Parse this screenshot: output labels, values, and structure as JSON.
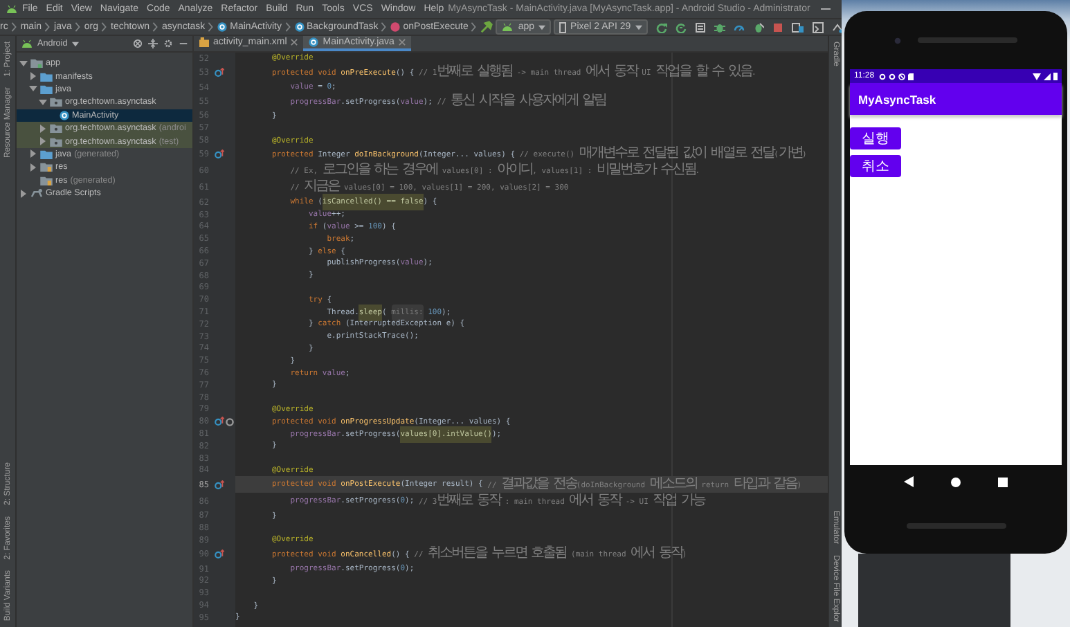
{
  "window": {
    "title": "MyAsyncTask - MainActivity.java [MyAsyncTask.app] - Android Studio - Administrator"
  },
  "menu": [
    "File",
    "Edit",
    "View",
    "Navigate",
    "Code",
    "Analyze",
    "Refactor",
    "Build",
    "Run",
    "Tools",
    "VCS",
    "Window",
    "Help"
  ],
  "breadcrumbs": [
    {
      "text": "rc",
      "kind": "folder"
    },
    {
      "text": "main",
      "kind": "folder"
    },
    {
      "text": "java",
      "kind": "folder"
    },
    {
      "text": "org",
      "kind": "folder"
    },
    {
      "text": "techtown",
      "kind": "folder"
    },
    {
      "text": "asynctask",
      "kind": "folder"
    },
    {
      "text": "MainActivity",
      "kind": "class"
    },
    {
      "text": "BackgroundTask",
      "kind": "class"
    },
    {
      "text": "onPostExecute",
      "kind": "method"
    }
  ],
  "run_config": "app",
  "device": "Pixel 2 API 29",
  "left_strip": {
    "top": [
      "1: Project",
      "Resource Manager"
    ],
    "bottom": [
      "2: Structure",
      "2: Favorites",
      "Build Variants"
    ]
  },
  "project": {
    "view": "Android",
    "tree": [
      {
        "name": "app",
        "kind": "module",
        "expanded": true,
        "selected": false,
        "children": [
          {
            "name": "manifests",
            "kind": "folder",
            "expanded": false,
            "selected": false
          },
          {
            "name": "java",
            "kind": "folder",
            "expanded": true,
            "selected": false,
            "children": [
              {
                "name": "org.techtown.asynctask",
                "kind": "package",
                "expanded": true,
                "selected": false,
                "children": [
                  {
                    "name": "MainActivity",
                    "kind": "class",
                    "selected": true
                  }
                ]
              },
              {
                "name": "org.techtown.asynctask",
                "note": "(androi",
                "kind": "test-package",
                "expanded": false,
                "selected": false
              },
              {
                "name": "org.techtown.asynctask",
                "note": "(test)",
                "kind": "test-package",
                "expanded": false,
                "selected": false
              }
            ]
          },
          {
            "name": "java",
            "note": "(generated)",
            "kind": "folder",
            "expanded": false,
            "selected": false
          },
          {
            "name": "res",
            "kind": "res-folder",
            "expanded": false,
            "selected": false
          },
          {
            "name": "res",
            "note": "(generated)",
            "kind": "res-folder",
            "selected": false
          }
        ]
      },
      {
        "name": "Gradle Scripts",
        "kind": "scripts",
        "expanded": false,
        "selected": false
      }
    ]
  },
  "tabs": [
    {
      "label": "activity_main.xml",
      "kind": "layout",
      "selected": false
    },
    {
      "label": "MainActivity.java",
      "kind": "class",
      "selected": true
    }
  ],
  "editor": {
    "lines": [
      {
        "number": "52",
        "current": false,
        "segments": [
          {
            "kind": "annotation",
            "text": "        @Override"
          }
        ]
      },
      {
        "number": "53",
        "current": false,
        "gutter_icons": [
          {
            "kind": "override"
          }
        ],
        "segments": [
          {
            "kind": "keyword",
            "text": "        protected void "
          },
          {
            "kind": "method",
            "text": "onPreExecute"
          },
          {
            "kind": "plain",
            "text": "() { "
          },
          {
            "kind": "comment",
            "text": "// 1번째로 실행됨 -> main thread 에서 동작 UI 작업을 할 수 있음."
          }
        ]
      },
      {
        "number": "54",
        "current": false,
        "segments": [
          {
            "kind": "field",
            "text": "            value"
          },
          {
            "kind": "plain",
            "text": " = "
          },
          {
            "kind": "number",
            "text": "0"
          },
          {
            "kind": "plain",
            "text": ";"
          }
        ]
      },
      {
        "number": "55",
        "current": false,
        "segments": [
          {
            "kind": "field",
            "text": "            progressBar"
          },
          {
            "kind": "plain",
            "text": ".setProgress("
          },
          {
            "kind": "field",
            "text": "value"
          },
          {
            "kind": "plain",
            "text": "); "
          },
          {
            "kind": "comment",
            "text": "// 통신 시작을 사용자에게 알림"
          }
        ]
      },
      {
        "number": "56",
        "current": false,
        "segments": [
          {
            "kind": "plain",
            "text": "        }"
          }
        ]
      },
      {
        "number": "57",
        "current": false
      },
      {
        "number": "58",
        "current": false,
        "segments": [
          {
            "kind": "annotation",
            "text": "        @Override"
          }
        ]
      },
      {
        "number": "59",
        "current": false,
        "gutter_icons": [
          {
            "kind": "override"
          }
        ],
        "segments": [
          {
            "kind": "keyword",
            "text": "        protected "
          },
          {
            "kind": "plain",
            "text": "Integer "
          },
          {
            "kind": "method",
            "text": "doInBackground"
          },
          {
            "kind": "plain",
            "text": "(Integer... values) { "
          },
          {
            "kind": "comment",
            "text": "// execute() 매개변수로 전달된 값이 배열로 전달(가변)"
          }
        ]
      },
      {
        "number": "60",
        "current": false,
        "segments": [
          {
            "kind": "comment",
            "text": "            // Ex, 로그인을 하는 경우에 values[0] : 아이디, values[1] : 비밀번호가 수신됨."
          }
        ]
      },
      {
        "number": "61",
        "current": false,
        "segments": [
          {
            "kind": "comment",
            "text": "            // 지금은 values[0] = 100, values[1] = 200, values[2] = 300"
          }
        ]
      },
      {
        "number": "62",
        "current": false,
        "segments": [
          {
            "kind": "keyword",
            "text": "            while "
          },
          {
            "kind": "plain",
            "text": "("
          },
          {
            "kind": "mark",
            "text": "isCancelled() == false"
          },
          {
            "kind": "plain",
            "text": ") {"
          }
        ]
      },
      {
        "number": "63",
        "current": false,
        "segments": [
          {
            "kind": "field",
            "text": "                value"
          },
          {
            "kind": "plain",
            "text": "++;"
          }
        ]
      },
      {
        "number": "64",
        "current": false,
        "segments": [
          {
            "kind": "keyword",
            "text": "                if "
          },
          {
            "kind": "plain",
            "text": "("
          },
          {
            "kind": "field",
            "text": "value"
          },
          {
            "kind": "plain",
            "text": " >= "
          },
          {
            "kind": "number",
            "text": "100"
          },
          {
            "kind": "plain",
            "text": ") {"
          }
        ]
      },
      {
        "number": "65",
        "current": false,
        "segments": [
          {
            "kind": "keyword",
            "text": "                    break"
          },
          {
            "kind": "plain",
            "text": ";"
          }
        ]
      },
      {
        "number": "66",
        "current": false,
        "segments": [
          {
            "kind": "plain",
            "text": "                } "
          },
          {
            "kind": "keyword",
            "text": "else "
          },
          {
            "kind": "plain",
            "text": "{"
          }
        ]
      },
      {
        "number": "67",
        "current": false,
        "segments": [
          {
            "kind": "plain",
            "text": "                    publishProgress("
          },
          {
            "kind": "field",
            "text": "value"
          },
          {
            "kind": "plain",
            "text": ");"
          }
        ]
      },
      {
        "number": "68",
        "current": false,
        "segments": [
          {
            "kind": "plain",
            "text": "                }"
          }
        ]
      },
      {
        "number": "69",
        "current": false
      },
      {
        "number": "70",
        "current": false,
        "segments": [
          {
            "kind": "keyword",
            "text": "                try "
          },
          {
            "kind": "plain",
            "text": "{"
          }
        ]
      },
      {
        "number": "71",
        "current": false,
        "segments": [
          {
            "kind": "plain",
            "text": "                    Thread."
          },
          {
            "kind": "mark",
            "text": "sleep"
          },
          {
            "kind": "plain",
            "text": "( "
          },
          {
            "kind": "hint",
            "text": "millis:"
          },
          {
            "kind": "number",
            "text": " 100"
          },
          {
            "kind": "plain",
            "text": ");"
          }
        ]
      },
      {
        "number": "72",
        "current": false,
        "segments": [
          {
            "kind": "plain",
            "text": "                } "
          },
          {
            "kind": "keyword",
            "text": "catch "
          },
          {
            "kind": "plain",
            "text": "(InterruptedException e) {"
          }
        ]
      },
      {
        "number": "73",
        "current": false,
        "segments": [
          {
            "kind": "plain",
            "text": "                    e.printStackTrace();"
          }
        ]
      },
      {
        "number": "74",
        "current": false,
        "segments": [
          {
            "kind": "plain",
            "text": "                }"
          }
        ]
      },
      {
        "number": "75",
        "current": false,
        "segments": [
          {
            "kind": "plain",
            "text": "            }"
          }
        ]
      },
      {
        "number": "76",
        "current": false,
        "segments": [
          {
            "kind": "keyword",
            "text": "            return "
          },
          {
            "kind": "field",
            "text": "value"
          },
          {
            "kind": "plain",
            "text": ";"
          }
        ]
      },
      {
        "number": "77",
        "current": false,
        "segments": [
          {
            "kind": "plain",
            "text": "        }"
          }
        ]
      },
      {
        "number": "78",
        "current": false
      },
      {
        "number": "79",
        "current": false,
        "segments": [
          {
            "kind": "annotation",
            "text": "        @Override"
          }
        ]
      },
      {
        "number": "80",
        "current": false,
        "gutter_icons": [
          {
            "kind": "override"
          },
          {
            "kind": "reference"
          }
        ],
        "segments": [
          {
            "kind": "keyword",
            "text": "        protected void "
          },
          {
            "kind": "method",
            "text": "onProgressUpdate"
          },
          {
            "kind": "plain",
            "text": "(Integer... values) {"
          }
        ]
      },
      {
        "number": "81",
        "current": false,
        "segments": [
          {
            "kind": "field",
            "text": "            progressBar"
          },
          {
            "kind": "plain",
            "text": ".setProgress("
          },
          {
            "kind": "mark",
            "text": "values[0].intValue()"
          },
          {
            "kind": "plain",
            "text": ");"
          }
        ]
      },
      {
        "number": "82",
        "current": false,
        "segments": [
          {
            "kind": "plain",
            "text": "        }"
          }
        ]
      },
      {
        "number": "83",
        "current": false
      },
      {
        "number": "84",
        "current": false,
        "segments": [
          {
            "kind": "annotation",
            "text": "        @Override"
          }
        ]
      },
      {
        "number": "85",
        "current": true,
        "gutter_icons": [
          {
            "kind": "override"
          }
        ],
        "segments": [
          {
            "kind": "keyword",
            "text": "        protected void "
          },
          {
            "kind": "method",
            "text": "onPostExecute"
          },
          {
            "kind": "plain",
            "text": "(Integer result) { "
          },
          {
            "kind": "comment",
            "text": "// 결과값을 전송(doInBackground 메소드의 return 타입과 같음)"
          }
        ]
      },
      {
        "number": "86",
        "current": false,
        "segments": [
          {
            "kind": "field",
            "text": "            progressBar"
          },
          {
            "kind": "plain",
            "text": ".setProgress("
          },
          {
            "kind": "number",
            "text": "0"
          },
          {
            "kind": "plain",
            "text": "); "
          },
          {
            "kind": "comment",
            "text": "// 3번째로 동작 : main thread 에서 동작 -> UI 작업 가능"
          }
        ]
      },
      {
        "number": "87",
        "current": false,
        "segments": [
          {
            "kind": "plain",
            "text": "        }"
          }
        ]
      },
      {
        "number": "88",
        "current": false
      },
      {
        "number": "89",
        "current": false,
        "segments": [
          {
            "kind": "annotation",
            "text": "        @Override"
          }
        ]
      },
      {
        "number": "90",
        "current": false,
        "gutter_icons": [
          {
            "kind": "override"
          }
        ],
        "segments": [
          {
            "kind": "keyword",
            "text": "        protected void "
          },
          {
            "kind": "method",
            "text": "onCancelled"
          },
          {
            "kind": "plain",
            "text": "() { "
          },
          {
            "kind": "comment",
            "text": "// 취소버튼을 누르면 호출됨 (main thread 에서 동작)"
          }
        ]
      },
      {
        "number": "91",
        "current": false,
        "segments": [
          {
            "kind": "field",
            "text": "            progressBar"
          },
          {
            "kind": "plain",
            "text": ".setProgress("
          },
          {
            "kind": "number",
            "text": "0"
          },
          {
            "kind": "plain",
            "text": ");"
          }
        ]
      },
      {
        "number": "92",
        "current": false,
        "segments": [
          {
            "kind": "plain",
            "text": "        }"
          }
        ]
      },
      {
        "number": "93",
        "current": false
      },
      {
        "number": "94",
        "current": false,
        "segments": [
          {
            "kind": "plain",
            "text": "    }"
          }
        ]
      },
      {
        "number": "95",
        "current": false,
        "segments": [
          {
            "kind": "plain",
            "text": "}"
          }
        ]
      }
    ]
  },
  "right_strip": {
    "top": [
      "Gradle"
    ],
    "bottom": [
      "Emulator",
      "Device File Explor"
    ]
  },
  "emulator": {
    "clock": "11:28",
    "app_title": "MyAsyncTask",
    "buttons": [
      "실행",
      "취소"
    ]
  }
}
